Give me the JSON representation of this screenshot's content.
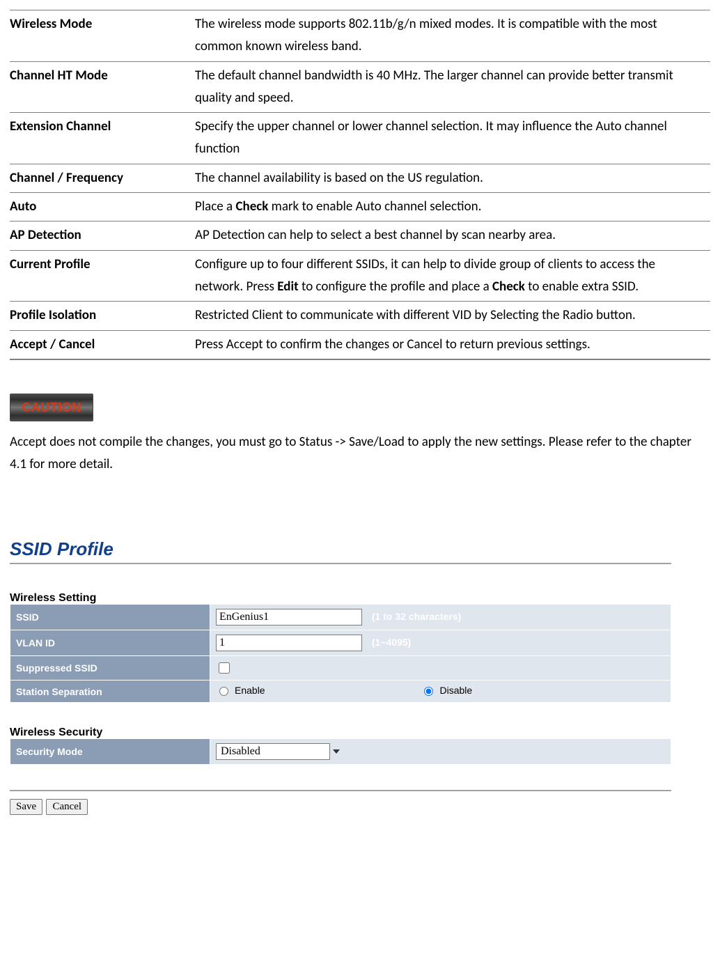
{
  "definitions": [
    {
      "label": "Wireless Mode",
      "desc_parts": [
        "The wireless mode supports 802.11b/g/n mixed modes. It is compatible with the most common known wireless band."
      ]
    },
    {
      "label": "Channel HT Mode",
      "desc_parts": [
        "The default channel bandwidth is 40 MHz. The larger channel can provide better transmit quality and speed."
      ]
    },
    {
      "label": "Extension Channel",
      "desc_parts": [
        "Specify the upper channel or lower channel selection. It may influence the Auto channel function"
      ]
    },
    {
      "label": "Channel / Frequency",
      "desc_parts": [
        "The channel availability is based on the US regulation."
      ]
    },
    {
      "label": "Auto",
      "desc_parts": [
        "Place a ",
        {
          "bold": "Check"
        },
        " mark to enable Auto channel selection."
      ]
    },
    {
      "label": "AP Detection",
      "desc_parts": [
        "AP Detection can help to select a best channel by scan nearby area."
      ]
    },
    {
      "label": "Current Profile",
      "desc_parts": [
        "Configure up to four different SSIDs, it can help to divide group of clients to access the network. Press ",
        {
          "bold": "Edit"
        },
        " to configure the profile and place a ",
        {
          "bold": "Check"
        },
        " to enable extra SSID."
      ]
    },
    {
      "label": "Profile Isolation",
      "desc_parts": [
        "Restricted Client to communicate with different VID by Selecting the Radio button."
      ]
    },
    {
      "label": "Accept / Cancel",
      "desc_parts": [
        "Press Accept to confirm the changes or Cancel to return previous settings."
      ]
    }
  ],
  "caution": {
    "badge": "CAUTION",
    "text": "Accept does not compile the changes, you must go to Status -> Save/Load to apply the new settings. Please refer to the chapter 4.1 for more detail."
  },
  "ssid_profile": {
    "title": "SSID Profile",
    "wireless_setting_heading": "Wireless Setting",
    "fields": {
      "ssid_label": "SSID",
      "ssid_value": "EnGenius1",
      "ssid_hint": "(1 to 32 characters)",
      "vlan_label": "VLAN ID",
      "vlan_value": "1",
      "vlan_hint": "(1~4095)",
      "suppressed_label": "Suppressed SSID",
      "suppressed_checked": false,
      "station_sep_label": "Station Separation",
      "station_sep_enable": "Enable",
      "station_sep_disable": "Disable",
      "station_sep_value": "Disable"
    },
    "wireless_security_heading": "Wireless Security",
    "security": {
      "mode_label": "Security Mode",
      "mode_value": "Disabled"
    },
    "buttons": {
      "save": "Save",
      "cancel": "Cancel"
    }
  }
}
